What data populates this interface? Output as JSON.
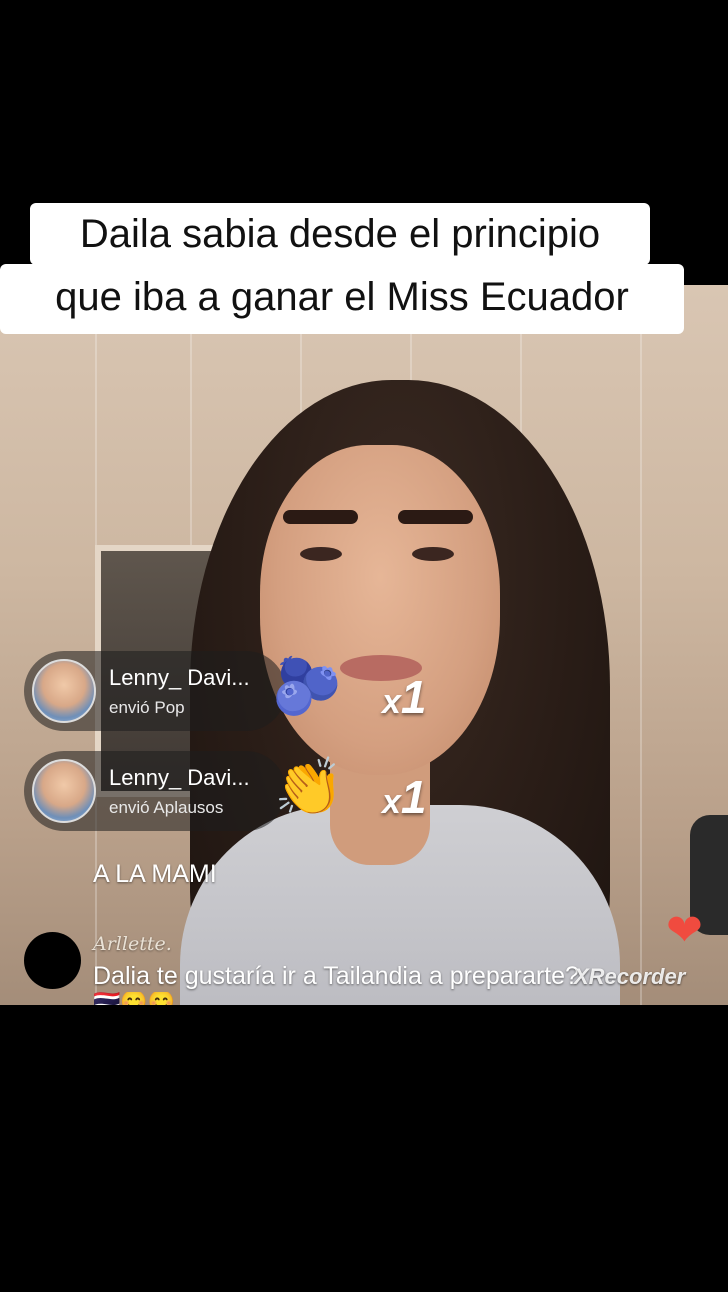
{
  "caption": {
    "line1": "Daila sabia desde el principio",
    "line2": "que iba a ganar  el Miss Ecuador"
  },
  "gifts": [
    {
      "username": "Lenny_ Davi...",
      "action": "envió Pop",
      "icon": "pop-gift-icon",
      "glyph": "🫐",
      "combo_prefix": "x",
      "combo_count": "1"
    },
    {
      "username": "Lenny_ Davi...",
      "action": "envió Aplausos",
      "icon": "clapping-hands-icon",
      "glyph": "👏",
      "combo_prefix": "x",
      "combo_count": "1"
    }
  ],
  "comments": {
    "plain": "A LA MAMI",
    "user": "Arllette.",
    "text": "Dalia te gustaría ir a Tailandia a prepararte?",
    "emoji": "🇹🇭😊😊"
  },
  "watermark": "XRecorder",
  "heart_glyph": "❤",
  "colors": {
    "heart": "#f04b3f",
    "caption_bg": "#ffffff",
    "gift_pill_bg": "rgba(30,30,30,0.55)"
  }
}
